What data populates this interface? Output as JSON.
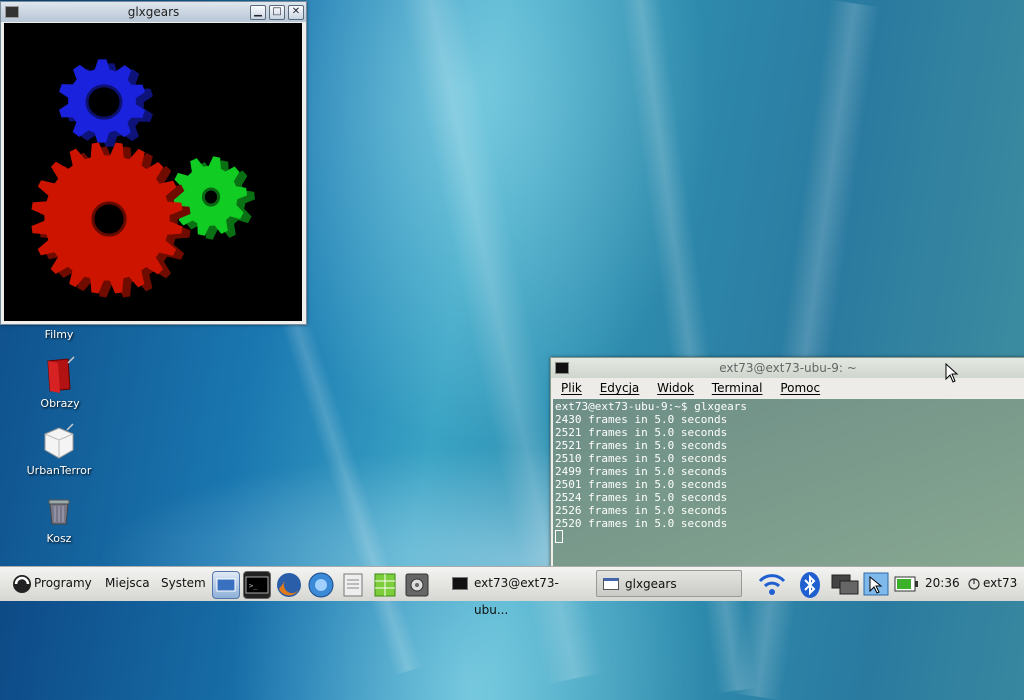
{
  "desktop": {
    "icons": [
      {
        "label": "Filmy",
        "icon": "video-folder-icon"
      },
      {
        "label": "Obrazy",
        "icon": "pictures-folder-icon"
      },
      {
        "label": "UrbanTerror",
        "icon": "urbanterror-icon"
      },
      {
        "label": "Kosz",
        "icon": "trash-icon"
      }
    ]
  },
  "glxgears_window": {
    "title": "glxgears",
    "buttons": [
      "minimize",
      "maximize",
      "close"
    ],
    "gear_colors": {
      "red": "#cc1400",
      "green": "#11cc22",
      "blue": "#1a22dd"
    }
  },
  "terminal": {
    "title": "ext73@ext73-ubu-9: ~",
    "menu": [
      "Plik",
      "Edycja",
      "Widok",
      "Terminal",
      "Pomoc"
    ],
    "lines": [
      "ext73@ext73-ubu-9:~$ glxgears",
      "2430 frames in 5.0 seconds",
      "2521 frames in 5.0 seconds",
      "2521 frames in 5.0 seconds",
      "2510 frames in 5.0 seconds",
      "2499 frames in 5.0 seconds",
      "2501 frames in 5.0 seconds",
      "2524 frames in 5.0 seconds",
      "2526 frames in 5.0 seconds",
      "2520 frames in 5.0 seconds"
    ]
  },
  "panel": {
    "menus": [
      "Programy",
      "Miejsca",
      "System"
    ],
    "launchers": [
      "show-desktop-icon",
      "terminal-icon",
      "firefox-icon",
      "browser-icon",
      "text-editor-icon",
      "spreadsheet-icon",
      "settings-icon"
    ],
    "tasks": [
      {
        "label": "ext73@ext73-ubu...",
        "icon": "terminal-icon",
        "active": false
      },
      {
        "label": "glxgears",
        "icon": "window-icon",
        "active": true
      }
    ],
    "tray_icons": [
      "wifi-icon",
      "bluetooth-icon",
      "network-icon",
      "pointer-icon",
      "battery-icon"
    ],
    "clock": "20:36",
    "user": "ext73"
  }
}
